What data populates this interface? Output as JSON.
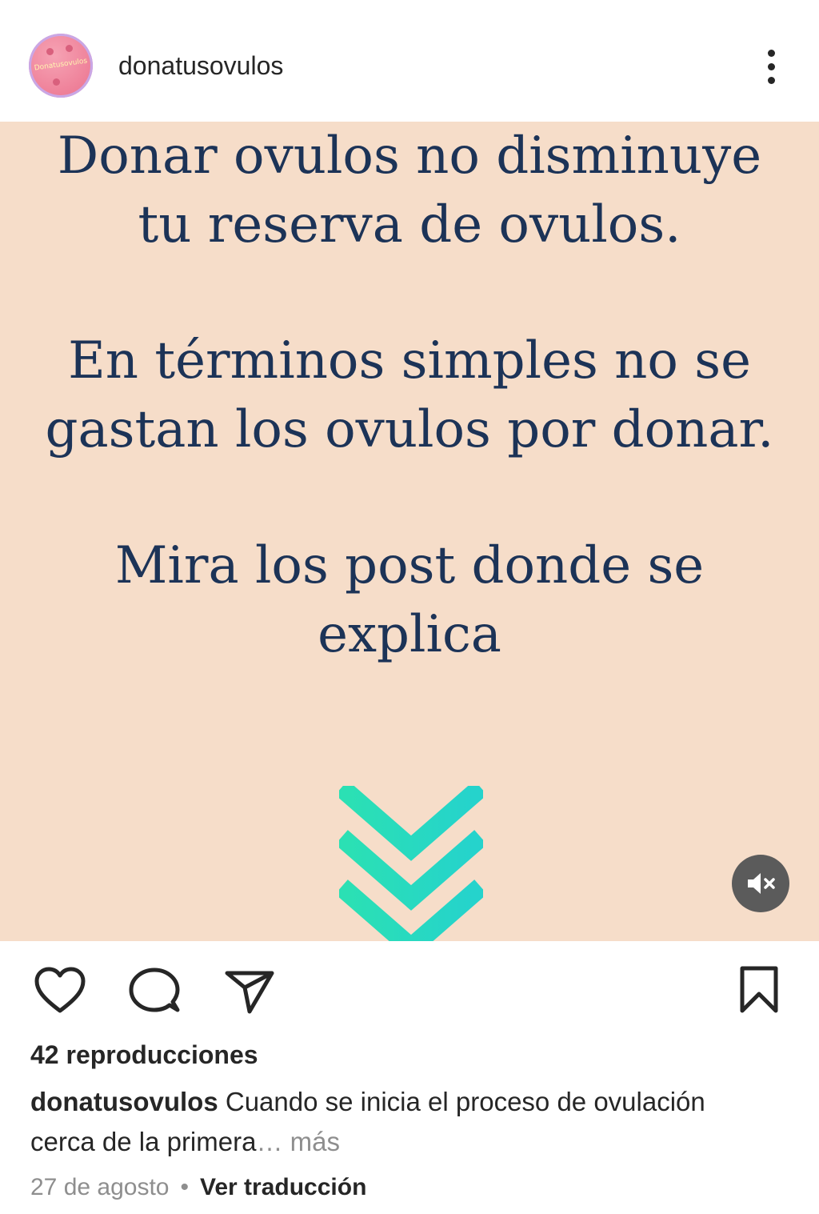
{
  "post": {
    "username": "donatusovulos",
    "avatar_text": "Donatusovulos",
    "media": {
      "background_color": "#f6ddc9",
      "text_color": "#1c3357",
      "arrow_color": "#27dbb3",
      "paragraphs": [
        [
          "Donar ovulos no disminuye",
          "tu reserva de ovulos."
        ],
        [
          "En términos simples no se",
          "gastan los ovulos por donar."
        ],
        [
          "Mira los post donde se",
          "explica"
        ]
      ]
    },
    "views": "42 reproducciones",
    "caption": {
      "username": "donatusovulos",
      "text_line1": "Cuando se inicia el proceso de ovulación",
      "text_line2": "cerca de la primera",
      "more": "… más"
    },
    "date": "27 de agosto",
    "separator": "•",
    "translate_label": "Ver traducción"
  },
  "icons": {
    "more": "more-vertical-icon",
    "like": "heart-icon",
    "comment": "comment-icon",
    "share": "send-icon",
    "save": "bookmark-icon",
    "mute": "speaker-muted-icon",
    "arrows": "chevrons-down-icon"
  }
}
